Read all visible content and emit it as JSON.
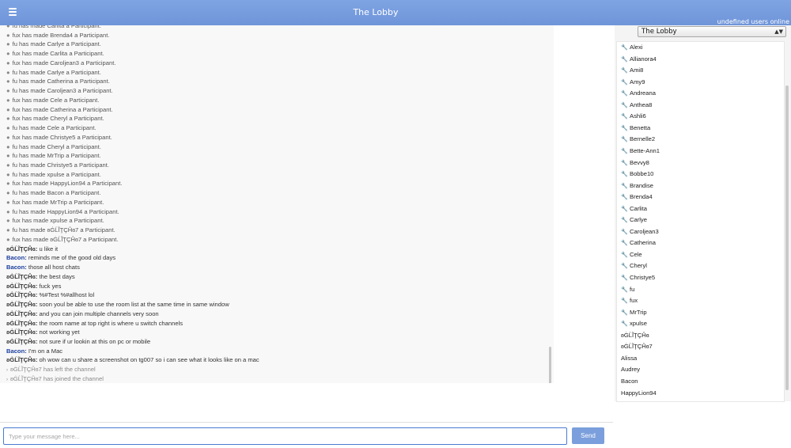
{
  "header": {
    "menu_icon": "hamburger-menu-icon",
    "title": "The Lobby",
    "users_online": "undefined users online"
  },
  "chat": {
    "messages": [
      {
        "type": "system",
        "text": "fu has made Carlita a Participant."
      },
      {
        "type": "system",
        "text": "fux has made Brenda4 a Participant."
      },
      {
        "type": "system",
        "text": "fu has made Carlye a Participant."
      },
      {
        "type": "system",
        "text": "fux has made Carlita a Participant."
      },
      {
        "type": "system",
        "text": "fux has made Caroljean3 a Participant."
      },
      {
        "type": "system",
        "text": "fu has made Carlye a Participant."
      },
      {
        "type": "system",
        "text": "fu has made Catherina a Participant."
      },
      {
        "type": "system",
        "text": "fu has made Caroljean3 a Participant."
      },
      {
        "type": "system",
        "text": "fux has made Cele a Participant."
      },
      {
        "type": "system",
        "text": "fux has made Catherina a Participant."
      },
      {
        "type": "system",
        "text": "fux has made Cheryl a Participant."
      },
      {
        "type": "system",
        "text": "fu has made Cele a Participant."
      },
      {
        "type": "system",
        "text": "fux has made Christye5 a Participant."
      },
      {
        "type": "system",
        "text": "fu has made Cheryl a Participant."
      },
      {
        "type": "system",
        "text": "fu has made MrTrip a Participant."
      },
      {
        "type": "system",
        "text": "fu has made Christye5 a Participant."
      },
      {
        "type": "system",
        "text": "fu has made xpulse a Participant."
      },
      {
        "type": "system",
        "text": "fux has made HappyLion94 a Participant."
      },
      {
        "type": "system",
        "text": "fu has made Bacon a Participant."
      },
      {
        "type": "system",
        "text": "fux has made MrTrip a Participant."
      },
      {
        "type": "system",
        "text": "fu has made HappyLion94 a Participant."
      },
      {
        "type": "system",
        "text": "fux has made xpulse a Participant."
      },
      {
        "type": "system",
        "text": "fu has made ʚĠĹĨŢÇĤɞ7 a Participant."
      },
      {
        "type": "system",
        "text": "fux has made ʚĠĹĨŢÇĤɞ7 a Participant."
      },
      {
        "type": "chat",
        "author": "ʚĠĹĨŢÇĤɞ:",
        "text": " u like it"
      },
      {
        "type": "chat",
        "author": "Bacon:",
        "text": " reminds me of the good old days",
        "bacon": true
      },
      {
        "type": "chat",
        "author": "Bacon:",
        "text": " those all host chats",
        "bacon": true
      },
      {
        "type": "chat",
        "author": "ʚĠĹĨŢÇĤɞ:",
        "text": " the best days"
      },
      {
        "type": "chat",
        "author": "ʚĠĹĨŢÇĤɞ:",
        "text": " fuck yes"
      },
      {
        "type": "chat",
        "author": "ʚĠĹĨŢÇĤɞ:",
        "text": " %#Test %#allhost lol"
      },
      {
        "type": "chat",
        "author": "ʚĠĹĨŢÇĤɞ:",
        "text": " soon youl be able to use the room list at the same time in same window"
      },
      {
        "type": "chat",
        "author": "ʚĠĹĨŢÇĤɞ:",
        "text": " and you can join multiple channels very soon"
      },
      {
        "type": "chat",
        "author": "ʚĠĹĨŢÇĤɞ:",
        "text": " the room name at top right is where u switch channels"
      },
      {
        "type": "chat",
        "author": "ʚĠĹĨŢÇĤɞ:",
        "text": " not working yet"
      },
      {
        "type": "chat",
        "author": "ʚĠĹĨŢÇĤɞ:",
        "text": " not sure if ur lookin at this on pc or mobile"
      },
      {
        "type": "chat",
        "author": "Bacon:",
        "text": " I'm on a Mac",
        "bacon": true
      },
      {
        "type": "chat",
        "author": "ʚĠĹĨŢÇĤɞ:",
        "text": " oh wow can u share a screenshot on tg007 so i can see what it looks like on a mac"
      },
      {
        "type": "channel",
        "text": "ʚĠĹĨŢÇĤɞ7 has left the channel"
      },
      {
        "type": "channel",
        "text": "ʚĠĹĨŢÇĤɞ7 has joined the channel"
      }
    ]
  },
  "room_selector": {
    "selected": "The Lobby",
    "arrows_icon": "select-arrows-icon"
  },
  "users": [
    {
      "name": "Alexi",
      "role": "wrench"
    },
    {
      "name": "Allianora4",
      "role": "wrench"
    },
    {
      "name": "Ami8",
      "role": "wrench"
    },
    {
      "name": "Amy9",
      "role": "wrench"
    },
    {
      "name": "Andreana",
      "role": "wrench"
    },
    {
      "name": "Anthea8",
      "role": "wrench"
    },
    {
      "name": "Ashli6",
      "role": "wrench"
    },
    {
      "name": "Benetta",
      "role": "wrench"
    },
    {
      "name": "Bernelle2",
      "role": "wrench"
    },
    {
      "name": "Bette-Ann1",
      "role": "wrench"
    },
    {
      "name": "Bevvy8",
      "role": "wrench"
    },
    {
      "name": "Bobbe10",
      "role": "wrench"
    },
    {
      "name": "Brandise",
      "role": "wrench"
    },
    {
      "name": "Brenda4",
      "role": "wrench"
    },
    {
      "name": "Carlita",
      "role": "wrench"
    },
    {
      "name": "Carlye",
      "role": "wrench"
    },
    {
      "name": "Caroljean3",
      "role": "wrench"
    },
    {
      "name": "Catherina",
      "role": "wrench"
    },
    {
      "name": "Cele",
      "role": "wrench"
    },
    {
      "name": "Cheryl",
      "role": "wrench"
    },
    {
      "name": "Christye5",
      "role": "wrench"
    },
    {
      "name": "fu",
      "role": "wrench"
    },
    {
      "name": "fux",
      "role": "wrench"
    },
    {
      "name": "MrTrip",
      "role": "wrench"
    },
    {
      "name": "xpulse",
      "role": "wrench"
    },
    {
      "name": "ʚĠĹĨŢÇĤɞ",
      "role": "none"
    },
    {
      "name": "ʚĠĹĨŢÇĤɞ7",
      "role": "none"
    },
    {
      "name": "Alissa",
      "role": "none"
    },
    {
      "name": "Audrey",
      "role": "none"
    },
    {
      "name": "Bacon",
      "role": "none"
    },
    {
      "name": "HappyLion94",
      "role": "none"
    }
  ],
  "composer": {
    "placeholder": "Type your message here...",
    "send_label": "Send"
  },
  "colors": {
    "header": "#7fa4e3",
    "send_button": "#7b9fdc",
    "bacon_author": "#1a3d9e"
  }
}
